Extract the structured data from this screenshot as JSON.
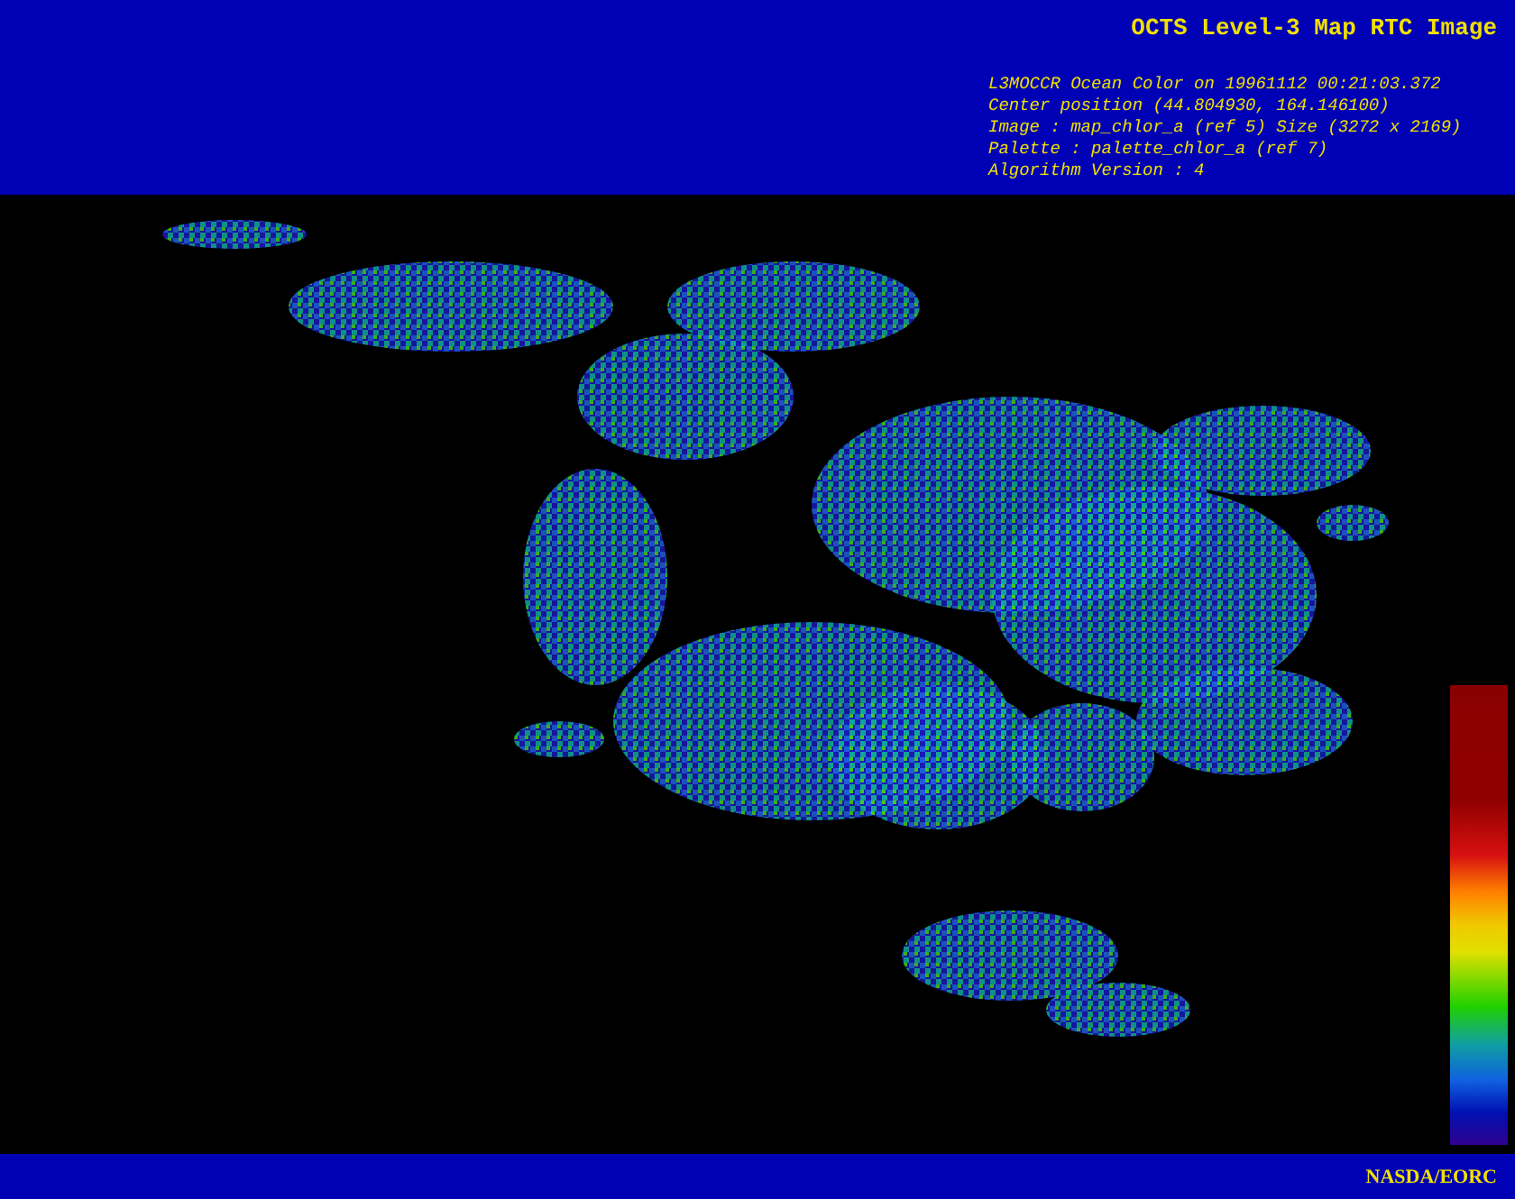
{
  "header": {
    "title": "OCTS Level-3 Map RTC Image",
    "info_lines": [
      "L3MOCCR Ocean Color on 19961112 00:21:03.372",
      "Center position (44.804930, 164.146100)",
      "Image : map_chlor_a (ref 5) Size (3272 x 2169)",
      "Palette : palette_chlor_a (ref 7)",
      "Algorithm Version : 4"
    ]
  },
  "footer": {
    "credit": "NASDA/EORC"
  }
}
